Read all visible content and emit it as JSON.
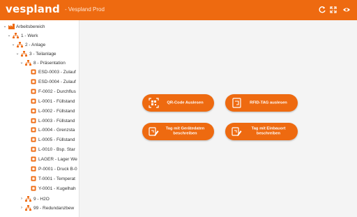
{
  "header": {
    "logo": "vespland",
    "environment": "- Vespland Prod",
    "icons": [
      "refresh-icon",
      "expand-icon",
      "eye-icon"
    ]
  },
  "tree": {
    "root": "Arbeitsbereich",
    "werk": "1 - Werk",
    "anlage": "2 - Anlage",
    "teilanlage": "3 - Teilanlage",
    "praesentation": "8 - Präsentation",
    "items": [
      "ESD-0003 - Zulauf",
      "ESD-0004 - Zulauf",
      "F-0002 - Durchflus",
      "L-0001 - Füllstand",
      "L-0002 - Füllstand",
      "L-0003 - Füllstand",
      "L-0004 - Grenzsta",
      "L-0005 - Füllstand",
      "L-0010 - Bsp. Star",
      "LAGER - Lager We",
      "P-0001 - Druck B-0",
      "T-0001 - Temperat",
      "Y-0001 - Kugelhah"
    ],
    "h2o": "9 - H2O",
    "redundanz": "99 - Redundanzbew"
  },
  "actions": {
    "qr": "QR-Code Auslesen",
    "rfid": "RFID-TAG auslesen",
    "tag_geraet": "Tag mit Gerätedaten beschreiben",
    "tag_einbau": "Tag mit Einbauort beschreiben"
  },
  "colors": {
    "accent": "#ee6a10",
    "background": "#f4f4f4"
  }
}
